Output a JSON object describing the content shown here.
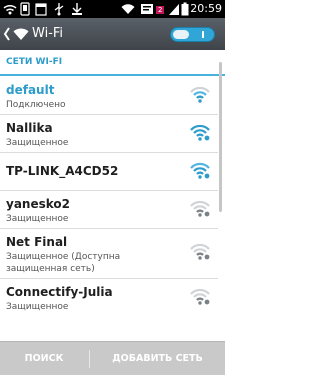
{
  "status_bar": {
    "time": "20:59",
    "notification_badge": "2"
  },
  "action_bar": {
    "title": "Wi-Fi",
    "toggle_state": "on"
  },
  "section": {
    "title": "СЕТИ WI-FI"
  },
  "networks": [
    {
      "name": "default",
      "status": "Подключено",
      "secured": false,
      "connected": true
    },
    {
      "name": "Nallika",
      "status": "Защищенное",
      "secured": true,
      "connected": false
    },
    {
      "name": "TP-LINK_A4CD52",
      "status": "",
      "secured": true,
      "connected": false
    },
    {
      "name": "yanesko2",
      "status": "Защищенное",
      "secured": true,
      "connected": false
    },
    {
      "name": "Net Final",
      "status": "Защищенное (Доступна",
      "status2": "защищенная сеть)",
      "secured": true,
      "connected": false
    },
    {
      "name": "Connectify-Julia",
      "status": "Защищенное",
      "secured": true,
      "connected": false
    }
  ],
  "bottom_bar": {
    "search_label": "ПОИСК",
    "add_label": "ДОБАВИТЬ СЕТЬ"
  },
  "colors": {
    "accent": "#2d9ccb",
    "toggle": "#2fa6d7",
    "bottom_bar": "#c9c9c9"
  },
  "icons": {
    "status_bar": [
      "wifi-signal-icon",
      "phone-icon",
      "calendar-icon",
      "usb-icon",
      "download-icon",
      "wifi-icon",
      "message-icon",
      "cellular-signal-icon",
      "battery-icon"
    ],
    "networks": "wifi-signal-icon",
    "secured_overlay": "lock-dot-icon"
  }
}
